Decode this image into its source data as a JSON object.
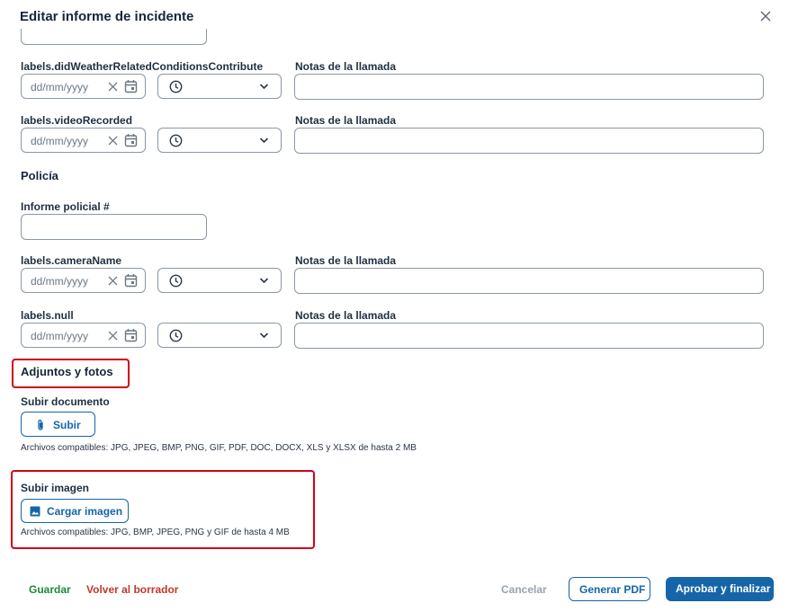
{
  "header": {
    "title": "Editar informe de incidente",
    "close_icon": "close-icon"
  },
  "rows": [
    {
      "label": "labels.didWeatherRelatedConditionsContribute",
      "date_placeholder": "dd/mm/yyyy",
      "notes_label": "Notas de la llamada"
    },
    {
      "label": "labels.videoRecorded",
      "date_placeholder": "dd/mm/yyyy",
      "notes_label": "Notas de la llamada"
    },
    {
      "label": "labels.cameraName",
      "date_placeholder": "dd/mm/yyyy",
      "notes_label": "Notas de la llamada"
    },
    {
      "label": "labels.null",
      "date_placeholder": "dd/mm/yyyy",
      "notes_label": "Notas de la llamada"
    }
  ],
  "police": {
    "section_title": "Policía",
    "report_label": "Informe policial #"
  },
  "attachments": {
    "section_title": "Adjuntos y fotos",
    "document": {
      "label": "Subir documento",
      "button": "Subir",
      "hint": "Archivos compatibles: JPG, JPEG, BMP, PNG, GIF, PDF, DOC, DOCX, XLS y XLSX de hasta 2 MB"
    },
    "image": {
      "label": "Subir imagen",
      "button": "Cargar imagen",
      "hint": "Archivos compatibles: JPG, BMP, JPEG, PNG y GIF de hasta 4 MB"
    }
  },
  "footer": {
    "save": "Guardar",
    "back_to_draft": "Volver al borrador",
    "cancel": "Cancelar",
    "generate_pdf": "Generar PDF",
    "approve": "Aprobar y finalizar"
  },
  "colors": {
    "primary": "#1565a8",
    "save_green": "#1e8a3c",
    "back_red": "#c0392b",
    "highlight_red": "#d0021b",
    "cancel_gray": "#9aa3ad"
  }
}
